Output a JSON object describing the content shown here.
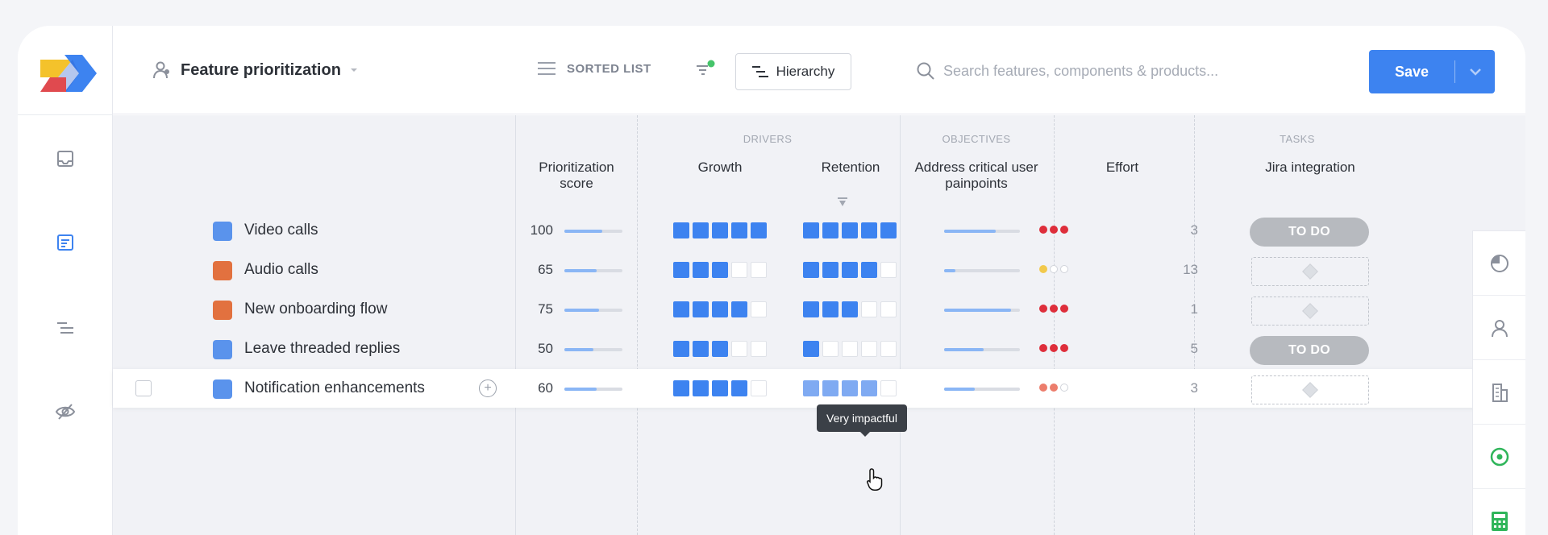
{
  "header": {
    "board_title": "Feature prioritization",
    "view_label": "SORTED LIST",
    "hierarchy_label": "Hierarchy",
    "search_placeholder": "Search features, components & products...",
    "save_label": "Save"
  },
  "column_groups": {
    "drivers": "DRIVERS",
    "objectives": "OBJECTIVES",
    "tasks": "TASKS"
  },
  "columns": {
    "score_l1": "Prioritization",
    "score_l2": "score",
    "growth": "Growth",
    "retention": "Retention",
    "objective_l1": "Address critical user",
    "objective_l2": "painpoints",
    "effort": "Effort",
    "jira": "Jira integration"
  },
  "colors": {
    "accent": "#3d83f0",
    "feature_blue": "#5a93ec",
    "feature_orange": "#e2713f"
  },
  "rows": [
    {
      "name": "Video calls",
      "color": "#5a93ec",
      "score": "100",
      "score_fraction": 0.65,
      "growth": 5,
      "retention": 5,
      "objective_fraction": 0.68,
      "objective_dots": [
        "red",
        "red",
        "red"
      ],
      "effort": "3",
      "task": "TO DO"
    },
    {
      "name": "Audio calls",
      "color": "#e2713f",
      "score": "65",
      "score_fraction": 0.55,
      "growth": 3,
      "retention": 4,
      "objective_fraction": 0.15,
      "objective_dots": [
        "yellow",
        "empty",
        "empty"
      ],
      "effort": "13",
      "task": ""
    },
    {
      "name": "New onboarding flow",
      "color": "#e2713f",
      "score": "75",
      "score_fraction": 0.6,
      "growth": 4,
      "retention": 3,
      "objective_fraction": 0.88,
      "objective_dots": [
        "red",
        "red",
        "red"
      ],
      "effort": "1",
      "task": ""
    },
    {
      "name": "Leave threaded replies",
      "color": "#5a93ec",
      "score": "50",
      "score_fraction": 0.5,
      "growth": 3,
      "retention": 1,
      "objective_fraction": 0.52,
      "objective_dots": [
        "red",
        "red",
        "red"
      ],
      "effort": "5",
      "task": "TO DO"
    },
    {
      "name": "Notification enhancements",
      "color": "#5a93ec",
      "score": "60",
      "score_fraction": 0.55,
      "growth": 4,
      "retention": 4,
      "objective_fraction": 0.4,
      "objective_dots": [
        "salmon",
        "salmon",
        "empty"
      ],
      "effort": "3",
      "task": ""
    }
  ],
  "tooltip": "Very impactful",
  "icons": {
    "rail": [
      "inbox-icon",
      "board-icon",
      "list-icon",
      "hidden-icon"
    ],
    "right_panel": [
      "pie-chart-icon",
      "user-icon",
      "building-icon",
      "target-icon",
      "calculator-icon"
    ]
  }
}
